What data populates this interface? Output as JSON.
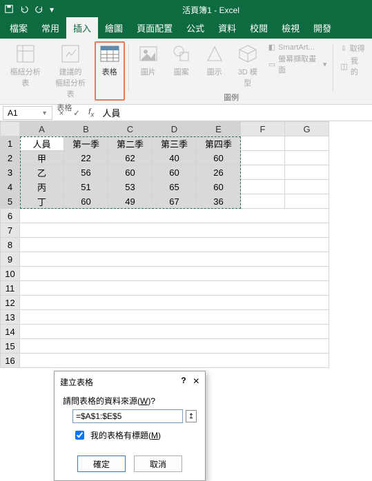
{
  "title": "活頁簿1 - Excel",
  "tabs": {
    "file": "檔案",
    "home": "常用",
    "insert": "插入",
    "draw": "繪圖",
    "layout": "頁面配置",
    "formula": "公式",
    "data": "資料",
    "review": "校閱",
    "view": "檢視",
    "dev": "開發"
  },
  "ribbon": {
    "group1_label": "表格",
    "group2_label": "圖例",
    "pivot": "樞紐分析表",
    "recpivot_l1": "建議的",
    "recpivot_l2": "樞紐分析表",
    "table": "表格",
    "pic": "圖片",
    "shapes": "圖案",
    "illus": "圖示",
    "model_l1": "3D 模",
    "model_l2": "型",
    "smartart": "SmartArt...",
    "screenshot": "螢幕擷取畫面",
    "get": "取得",
    "my": "我的"
  },
  "namebox": "A1",
  "formula": "人員",
  "cols": [
    "A",
    "B",
    "C",
    "D",
    "E",
    "F",
    "G"
  ],
  "rows": [
    "1",
    "2",
    "3",
    "4",
    "5",
    "6",
    "7",
    "8",
    "9",
    "10",
    "11",
    "12",
    "13",
    "14",
    "15",
    "16"
  ],
  "table_data": {
    "headers": [
      "人員",
      "第一季",
      "第二季",
      "第三季",
      "第四季"
    ],
    "rows": [
      [
        "甲",
        "22",
        "62",
        "40",
        "60"
      ],
      [
        "乙",
        "56",
        "60",
        "60",
        "26"
      ],
      [
        "丙",
        "51",
        "53",
        "65",
        "60"
      ],
      [
        "丁",
        "60",
        "49",
        "67",
        "36"
      ]
    ]
  },
  "dialog": {
    "title": "建立表格",
    "help": "?",
    "close": "×",
    "question": "請問表格的資料來源(",
    "question_key": "W",
    "question_end": ")?",
    "range": "=$A$1:$E$5",
    "checkbox": "我的表格有標題(",
    "checkbox_key": "M",
    "checkbox_end": ")",
    "ok": "確定",
    "cancel": "取消"
  }
}
